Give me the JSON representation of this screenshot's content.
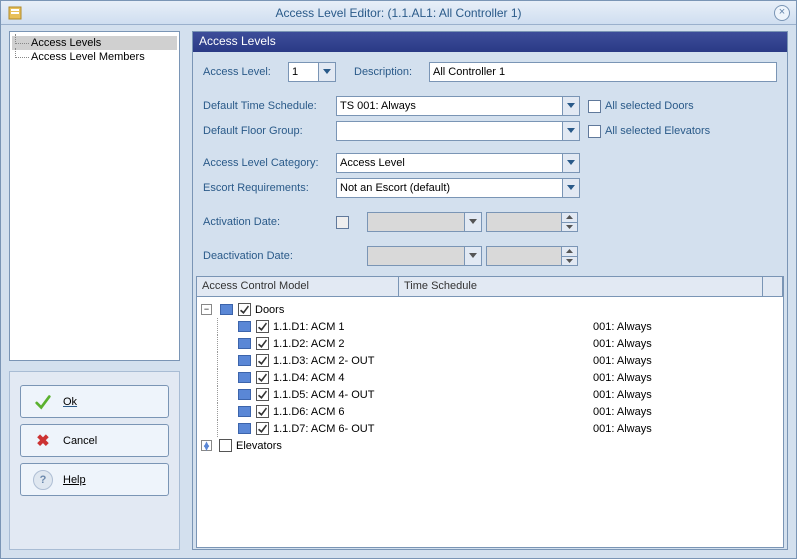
{
  "window": {
    "title": "Access Level Editor: (1.1.AL1: All Controller 1)"
  },
  "nav": {
    "item_access_levels": "Access Levels",
    "item_members": "Access Level Members"
  },
  "buttons": {
    "ok": "Ok",
    "cancel": "Cancel",
    "help": "Help"
  },
  "panel": {
    "title": "Access Levels",
    "labels": {
      "access_level": "Access Level:",
      "description": "Description:",
      "default_ts": "Default Time Schedule:",
      "default_fg": "Default Floor Group:",
      "category": "Access Level Category:",
      "escort": "Escort Requirements:",
      "activation": "Activation Date:",
      "deactivation": "Deactivation Date:"
    },
    "values": {
      "access_level": "1",
      "description": "All Controller 1",
      "default_ts": "TS 001:  Always",
      "default_fg": "",
      "category": "Access Level",
      "escort": "Not an Escort (default)"
    },
    "checkboxes": {
      "all_doors": "All selected Doors",
      "all_elev": "All selected Elevators"
    }
  },
  "grid": {
    "col_acm": "Access Control Model",
    "col_ts": "Time Schedule",
    "group_doors": "Doors",
    "group_elev": "Elevators",
    "rows": [
      {
        "name": "1.1.D1: ACM 1",
        "ts": "001:  Always"
      },
      {
        "name": "1.1.D2: ACM 2",
        "ts": "001:  Always"
      },
      {
        "name": "1.1.D3: ACM 2- OUT",
        "ts": "001:  Always"
      },
      {
        "name": "1.1.D4: ACM 4",
        "ts": "001:  Always"
      },
      {
        "name": "1.1.D5: ACM 4- OUT",
        "ts": "001:  Always"
      },
      {
        "name": "1.1.D6: ACM 6",
        "ts": "001:  Always"
      },
      {
        "name": "1.1.D7: ACM 6- OUT",
        "ts": "001:  Always"
      }
    ]
  }
}
